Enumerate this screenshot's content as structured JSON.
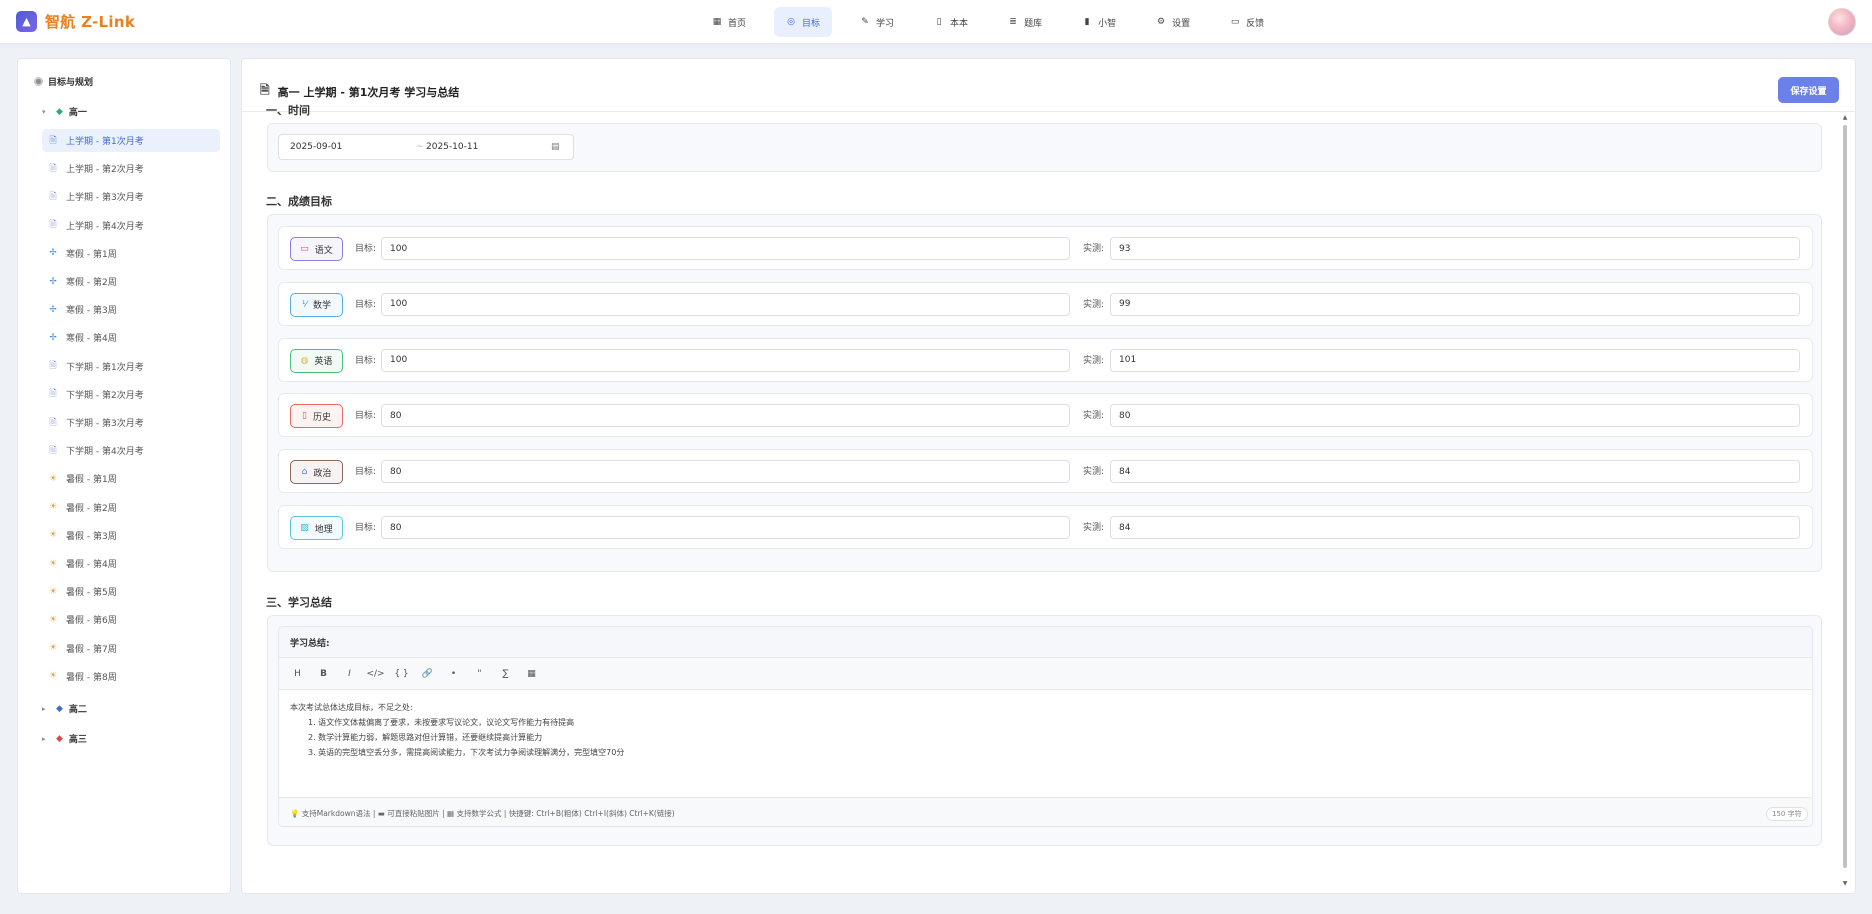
{
  "app": {
    "name": "智航 Z-Link",
    "logo_icon": "graduation-cap"
  },
  "nav": [
    {
      "label": "首页",
      "icon": "▦",
      "active": false
    },
    {
      "label": "目标",
      "icon": "◎",
      "active": true
    },
    {
      "label": "学习",
      "icon": "✎",
      "active": false
    },
    {
      "label": "本本",
      "icon": "▯",
      "active": false
    },
    {
      "label": "题库",
      "icon": "≣",
      "active": false
    },
    {
      "label": "小智",
      "icon": "▮",
      "active": false
    },
    {
      "label": "设置",
      "icon": "⚙",
      "active": false
    },
    {
      "label": "反馈",
      "icon": "▭",
      "active": false
    }
  ],
  "sidebar": {
    "title": "目标与规划",
    "grades": [
      {
        "label": "高一",
        "expanded": true,
        "color": "#2fae6b"
      },
      {
        "label": "高二",
        "expanded": false,
        "color": "#3f6bd9"
      },
      {
        "label": "高三",
        "expanded": false,
        "color": "#e04848"
      }
    ],
    "items": [
      {
        "label": "上学期 - 第1次月考",
        "icon": "doc",
        "active": true
      },
      {
        "label": "上学期 - 第2次月考",
        "icon": "doc"
      },
      {
        "label": "上学期 - 第3次月考",
        "icon": "doc"
      },
      {
        "label": "上学期 - 第4次月考",
        "icon": "doc"
      },
      {
        "label": "寒假 - 第1周",
        "icon": "snow"
      },
      {
        "label": "寒假 - 第2周",
        "icon": "snow"
      },
      {
        "label": "寒假 - 第3周",
        "icon": "snow"
      },
      {
        "label": "寒假 - 第4周",
        "icon": "snow"
      },
      {
        "label": "下学期 - 第1次月考",
        "icon": "doc"
      },
      {
        "label": "下学期 - 第2次月考",
        "icon": "doc"
      },
      {
        "label": "下学期 - 第3次月考",
        "icon": "doc"
      },
      {
        "label": "下学期 - 第4次月考",
        "icon": "doc"
      },
      {
        "label": "暑假 - 第1周",
        "icon": "sun"
      },
      {
        "label": "暑假 - 第2周",
        "icon": "sun"
      },
      {
        "label": "暑假 - 第3周",
        "icon": "sun"
      },
      {
        "label": "暑假 - 第4周",
        "icon": "sun"
      },
      {
        "label": "暑假 - 第5周",
        "icon": "sun"
      },
      {
        "label": "暑假 - 第6周",
        "icon": "sun"
      },
      {
        "label": "暑假 - 第7周",
        "icon": "sun"
      },
      {
        "label": "暑假 - 第8周",
        "icon": "sun"
      }
    ]
  },
  "main": {
    "title": "高一 上学期 - 第1次月考 学习与总结",
    "save_label": "保存设置",
    "section_time": "一、时间",
    "date_start": "2025-09-01",
    "date_sep": "~",
    "date_end": "2025-10-11",
    "section_scores": "二、成绩目标",
    "target_label": "目标:",
    "actual_label": "实测:",
    "subjects": [
      {
        "name": "语文",
        "target": "100",
        "actual": "93",
        "color": "#8b7fe0",
        "icon": "▭",
        "icon_color": "#e04848"
      },
      {
        "name": "数学",
        "target": "100",
        "actual": "99",
        "color": "#5aaee8",
        "icon": "⅟",
        "icon_color": "#3f8fd9"
      },
      {
        "name": "英语",
        "target": "100",
        "actual": "101",
        "color": "#4cc17e",
        "icon": "◍",
        "icon_color": "#e8b23a"
      },
      {
        "name": "历史",
        "target": "80",
        "actual": "80",
        "color": "#e86a5a",
        "icon": "▯",
        "icon_color": "#e8592e"
      },
      {
        "name": "政治",
        "target": "80",
        "actual": "84",
        "color": "#8a6a5a",
        "icon": "⌂",
        "icon_color": "#6a7bd9"
      },
      {
        "name": "地理",
        "target": "80",
        "actual": "84",
        "color": "#5ac8e0",
        "icon": "▨",
        "icon_color": "#3fb2d9"
      }
    ],
    "section_summary": "三、学习总结",
    "editor": {
      "header": "学习总结:",
      "toolbar": [
        "H",
        "B",
        "I",
        "</>",
        "{ }",
        "🔗",
        "•",
        "\"",
        "∑",
        "▦"
      ],
      "intro": "本次考试总体达成目标，不足之处:",
      "points": [
        "1. 语文作文体裁偏离了要求，未按要求写议论文，议论文写作能力有待提高",
        "2. 数学计算能力弱，解题思路对但计算错，还要继续提高计算能力",
        "3. 英语的完型填空丢分多，需提高阅读能力，下次考试力争阅读理解满分，完型填空70分"
      ],
      "footer": "💡 支持Markdown语法 | ▬ 可直接粘贴图片 | ▦ 支持数学公式 | 快捷键: Ctrl+B(粗体) Ctrl+I(斜体) Ctrl+K(链接)",
      "char_count": "150 字符"
    }
  }
}
